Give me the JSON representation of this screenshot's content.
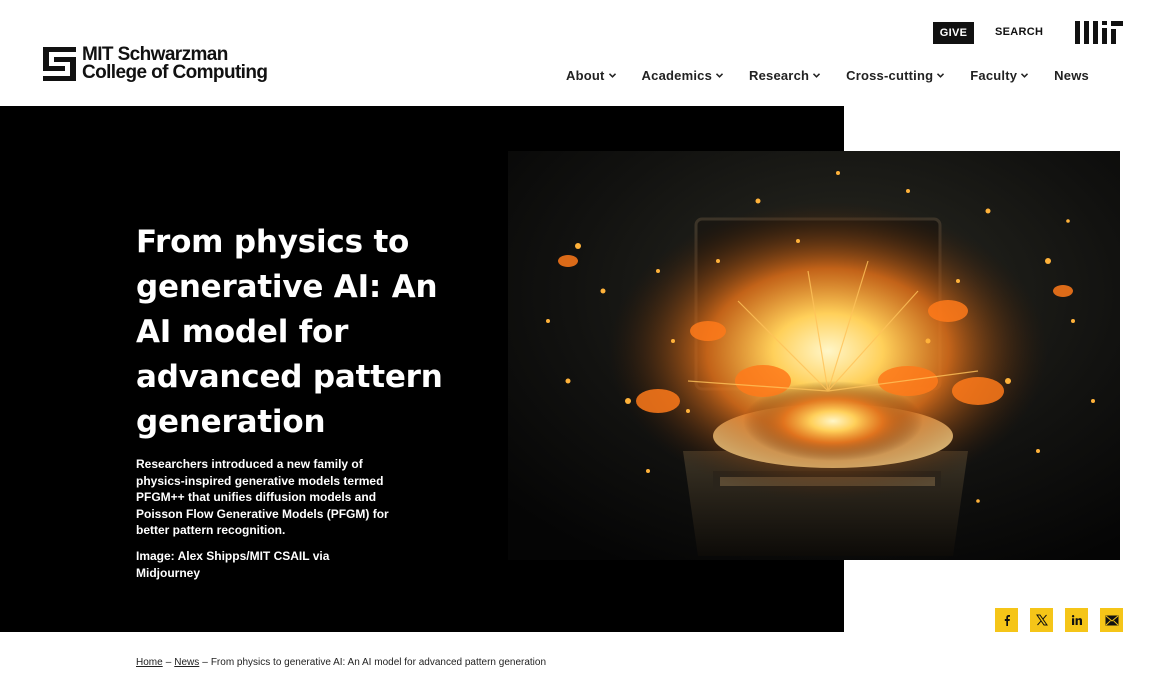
{
  "header": {
    "logo_line1": "MIT Schwarzman",
    "logo_line2": "College of Computing",
    "give_label": "GIVE",
    "search_label": "SEARCH",
    "mit_logo_icon": "mit-wordmark-icon"
  },
  "nav": {
    "items": [
      {
        "label": "About",
        "has_dropdown": true
      },
      {
        "label": "Academics",
        "has_dropdown": true
      },
      {
        "label": "Research",
        "has_dropdown": true
      },
      {
        "label": "Cross-cutting",
        "has_dropdown": true
      },
      {
        "label": "Faculty",
        "has_dropdown": true
      },
      {
        "label": "News",
        "has_dropdown": false
      }
    ]
  },
  "hero": {
    "title": "From physics to generative AI: An AI model for advanced pattern generation",
    "description": "Researchers introduced a new family of physics-inspired generative models termed PFGM++ that unifies diffusion models and Poisson Flow Generative Models (PFGM) for better pattern recognition.",
    "image_credit": "Image: Alex Shipps/MIT CSAIL via Midjourney",
    "image_icon": "exploding-laptop-image"
  },
  "share": {
    "icons": [
      "facebook-icon",
      "x-icon",
      "linkedin-icon",
      "email-icon"
    ],
    "accent_color": "#f5c518"
  },
  "breadcrumb": {
    "home": "Home",
    "news": "News",
    "current": "From physics to generative AI: An AI model for advanced pattern generation",
    "separator": "–"
  },
  "colors": {
    "hero_background": "#000000",
    "share_button": "#f5c518",
    "text_dark": "#111111"
  }
}
